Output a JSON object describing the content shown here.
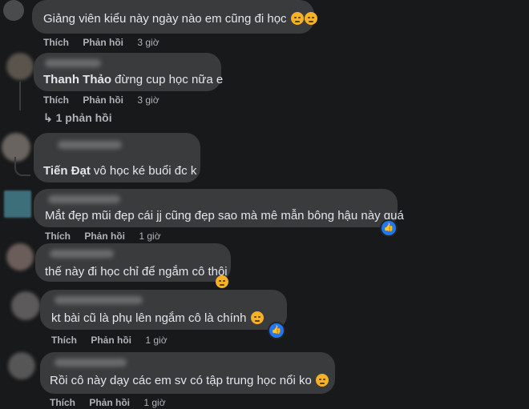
{
  "comments": [
    {
      "author": "",
      "text": "Giảng viên kiểu này ngày nào em cũng đi học",
      "emoji": [
        "disappointed-face",
        "disappointed-face"
      ],
      "like_label": "Thích",
      "reply_label": "Phản hồi",
      "time": "3 giờ"
    },
    {
      "author": "Thanh Thảo",
      "text": "đừng cup học nữa e",
      "like_label": "Thích",
      "reply_label": "Phản hồi",
      "time": "3 giờ",
      "replies_link": "1 phản hồi"
    },
    {
      "author": "Tiến Đạt",
      "text": "vô học ké buổi đc k"
    },
    {
      "author": "",
      "text": "Mắt đẹp mũi đẹp cái jj cũng đẹp sao mà mê mẫn bông hậu này quá",
      "like_label": "Thích",
      "reply_label": "Phản hồi",
      "time": "1 giờ",
      "reaction": "like"
    },
    {
      "author": "",
      "text": "thế này đi học chỉ để ngắm cô thôi",
      "emoji": [
        "grinning-face"
      ]
    },
    {
      "author": "",
      "text": "kt bài cũ là phụ lên ngắm cô là chính",
      "emoji": [
        "face-with-hand-over-mouth"
      ],
      "like_label": "Thích",
      "reply_label": "Phản hồi",
      "time": "1 giờ",
      "reaction": "like"
    },
    {
      "author": "",
      "text": "Rồi cô này dạy các em sv có tập trung học nổi ko",
      "emoji": [
        "laughing-face"
      ],
      "like_label": "Thích",
      "reply_label": "Phản hồi",
      "time": "1 giờ"
    }
  ],
  "colors": {
    "background": "#18191a",
    "bubble": "#3a3b3c",
    "text": "#e4e6eb",
    "secondary_text": "#b0b3b8",
    "like_blue": "#2078f4",
    "emoji_yellow": "#f7b125"
  }
}
